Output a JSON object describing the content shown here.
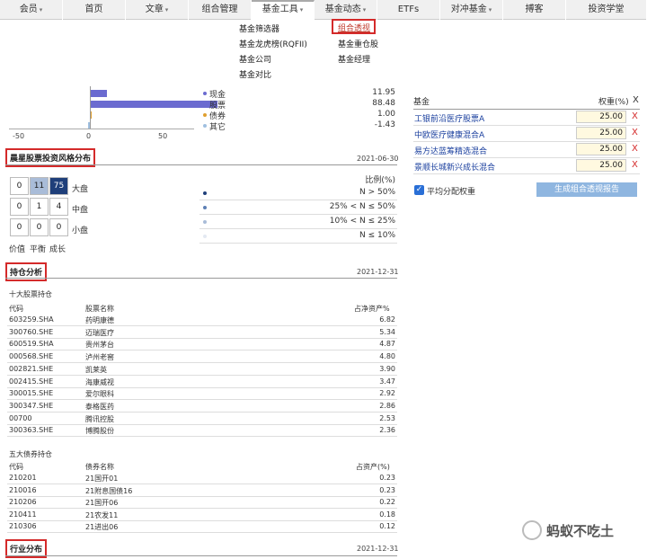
{
  "nav": {
    "items": [
      {
        "label": "会员",
        "caret": true
      },
      {
        "label": "首页",
        "caret": false
      },
      {
        "label": "文章",
        "caret": true
      },
      {
        "label": "组合管理",
        "caret": false
      },
      {
        "label": "基金工具",
        "caret": true
      },
      {
        "label": "基金动态",
        "caret": true
      },
      {
        "label": "ETFs",
        "caret": false
      },
      {
        "label": "对冲基金",
        "caret": true
      },
      {
        "label": "搏客",
        "caret": false
      },
      {
        "label": "投资学堂",
        "caret": false
      }
    ],
    "caret_glyph": "▾"
  },
  "submenu": {
    "left": [
      "基金筛选器",
      "基金龙虎榜(RQFII)",
      "基金公司",
      "基金对比"
    ],
    "right": [
      "组合透视",
      "基金重仓股",
      "基金经理"
    ]
  },
  "allocation": {
    "ticks": [
      "-50",
      "0",
      "50"
    ],
    "items": [
      {
        "label": "现金",
        "value": "11.95",
        "color": "#6b6bd0",
        "pct": 11.95
      },
      {
        "label": "股票",
        "value": "88.48",
        "color": "#6b6bd0",
        "pct": 88.48
      },
      {
        "label": "债券",
        "value": "1.00",
        "color": "#e0a030",
        "pct": 1.0
      },
      {
        "label": "其它",
        "value": "-1.43",
        "color": "#a0c0e0",
        "pct": -1.43
      }
    ]
  },
  "style_section": {
    "title": "晨星股票投资风格分布",
    "date": "2021-06-30",
    "grid": [
      [
        "0",
        "11",
        "75"
      ],
      [
        "0",
        "1",
        "4"
      ],
      [
        "0",
        "0",
        "0"
      ]
    ],
    "row_labels": [
      "大盘",
      "中盘",
      "小盘"
    ],
    "col_labels": [
      "价值",
      "平衡",
      "成长"
    ],
    "ratio_header": "比例(%)",
    "ratios": [
      "N > 50%",
      "25% < N ≤ 50%",
      "10% < N ≤ 25%",
      "N ≤ 10%"
    ],
    "ratio_colors": [
      "#1f3f7a",
      "#5d7fb5",
      "#a9bcd8",
      "#e3e9f2"
    ]
  },
  "holdings": {
    "title": "持仓分析",
    "date": "2021-12-31",
    "stock_subtitle": "十大股票持仓",
    "stock_headers": [
      "代码",
      "股票名称",
      "占净资产%"
    ],
    "stocks": [
      [
        "603259.SHA",
        "药明康德",
        "6.82"
      ],
      [
        "300760.SHE",
        "迈瑞医疗",
        "5.34"
      ],
      [
        "600519.SHA",
        "贵州茅台",
        "4.87"
      ],
      [
        "000568.SHE",
        "泸州老窖",
        "4.80"
      ],
      [
        "002821.SHE",
        "凯莱英",
        "3.90"
      ],
      [
        "002415.SHE",
        "海康威视",
        "3.47"
      ],
      [
        "300015.SHE",
        "爱尔眼科",
        "2.92"
      ],
      [
        "300347.SHE",
        "泰格医药",
        "2.86"
      ],
      [
        "00700",
        "腾讯控股",
        "2.53"
      ],
      [
        "300363.SHE",
        "博腾股份",
        "2.36"
      ]
    ],
    "bond_subtitle": "五大债券持仓",
    "bond_headers": [
      "代码",
      "债券名称",
      "占资产(%)"
    ],
    "bonds": [
      [
        "210201",
        "21国开01",
        "0.23"
      ],
      [
        "210016",
        "21附息国债16",
        "0.23"
      ],
      [
        "210206",
        "21国开06",
        "0.22"
      ],
      [
        "210411",
        "21农发11",
        "0.18"
      ],
      [
        "210306",
        "21进出06",
        "0.12"
      ]
    ]
  },
  "industry": {
    "title": "行业分布",
    "date": "2021-12-31"
  },
  "portfolio": {
    "header_fund": "基金",
    "header_weight": "权重(%)",
    "remove_glyph": "X",
    "funds": [
      {
        "name": "工银前沿医疗股票A",
        "weight": "25.00"
      },
      {
        "name": "中欧医疗健康混合A",
        "weight": "25.00"
      },
      {
        "name": "易方达蓝筹精选混合",
        "weight": "25.00"
      },
      {
        "name": "景顺长城新兴成长混合",
        "weight": "25.00"
      }
    ],
    "avg_weight_label": "平均分配权重",
    "avg_weight_checked": true,
    "generate_button": "生成组合透视报告"
  },
  "watermark": "蚂蚁不吃土"
}
